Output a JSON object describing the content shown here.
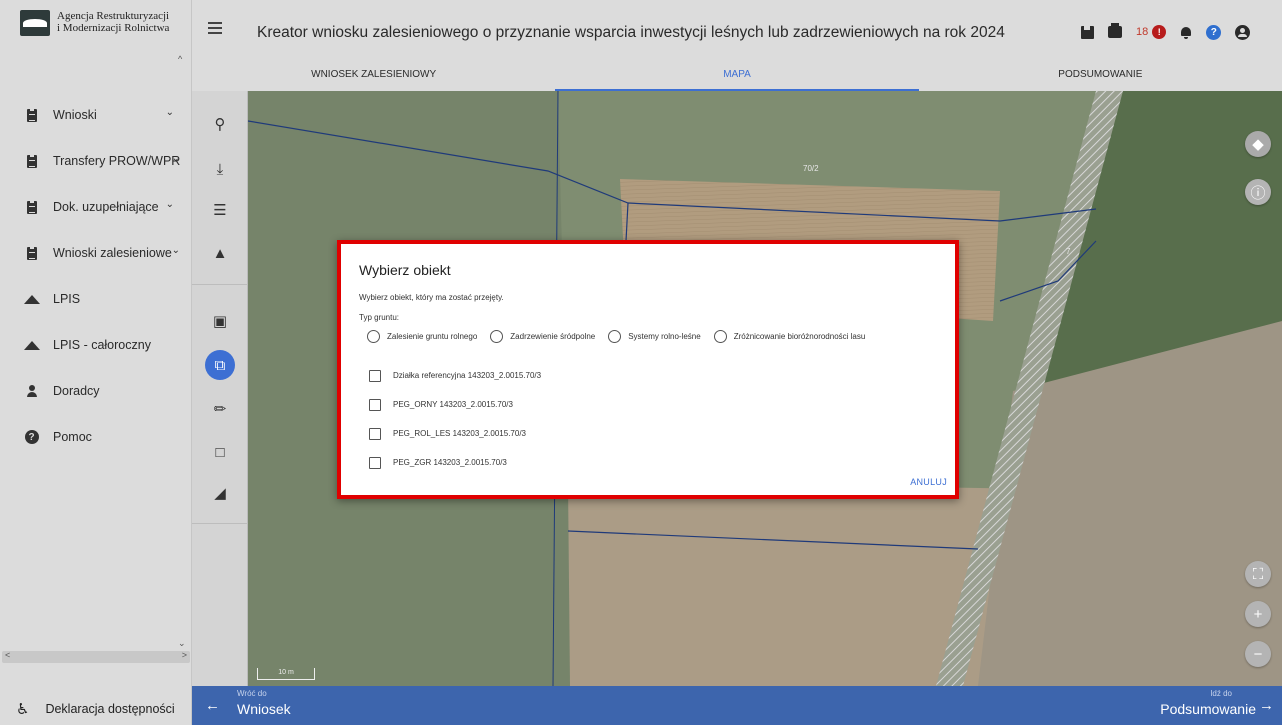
{
  "sidebar": {
    "logo_line1": "Agencja Restrukturyzacji",
    "logo_line2": "i Modernizacji Rolnictwa",
    "items": [
      {
        "label": "Wnioski",
        "icon": "document-icon",
        "chevron": true
      },
      {
        "label": "Transfery PROW/WPR",
        "icon": "document-icon",
        "chevron": true
      },
      {
        "label": "Dok. uzupełniające",
        "icon": "document-icon",
        "chevron": true
      },
      {
        "label": "Wnioski zalesieniowe",
        "icon": "document-icon",
        "chevron": true
      },
      {
        "label": "LPIS",
        "icon": "mountain-icon",
        "chevron": false
      },
      {
        "label": "LPIS - całoroczny",
        "icon": "mountain-icon",
        "chevron": false
      },
      {
        "label": "Doradcy",
        "icon": "person-icon",
        "chevron": false
      },
      {
        "label": "Pomoc",
        "icon": "help-icon",
        "chevron": false
      }
    ],
    "accessibility_label": "Deklaracja dostępności"
  },
  "header": {
    "title": "Kreator wniosku zalesieniowego o przyznanie wsparcia inwestycji leśnych lub zadrzewieniowych na rok 2024",
    "notification_count": "18",
    "alert_badge": "!",
    "help_glyph": "?"
  },
  "tabs": [
    {
      "label": "WNIOSEK ZALESIENIOWY",
      "active": false
    },
    {
      "label": "MAPA",
      "active": true
    },
    {
      "label": "PODSUMOWANIE",
      "active": false
    }
  ],
  "map": {
    "parcel_label_1": "70/2",
    "parcel_label_2": "7",
    "scale_label": "10 m"
  },
  "dialog": {
    "title": "Wybierz obiekt",
    "subtitle": "Wybierz obiekt, który ma zostać przejęty.",
    "type_label": "Typ gruntu:",
    "radio_options": [
      "Zalesienie gruntu rolnego",
      "Zadrzewienie śródpolne",
      "Systemy rolno-leśne",
      "Zróżnicowanie bioróżnorodności lasu"
    ],
    "checkbox_options": [
      "Działka referencyjna 143203_2.0015.70/3",
      "PEG_ORNY 143203_2.0015.70/3",
      "PEG_ROL_LES 143203_2.0015.70/3",
      "PEG_ZGR 143203_2.0015.70/3"
    ],
    "cancel_label": "ANULUJ"
  },
  "footer": {
    "back_small": "Wróć do",
    "back_label": "Wniosek",
    "next_small": "Idź do",
    "next_label": "Podsumowanie"
  },
  "colors": {
    "accent": "#3d6fd3",
    "bottom_bar": "#3d65ad",
    "dialog_border": "#e00000",
    "alert": "#b71c1c"
  }
}
